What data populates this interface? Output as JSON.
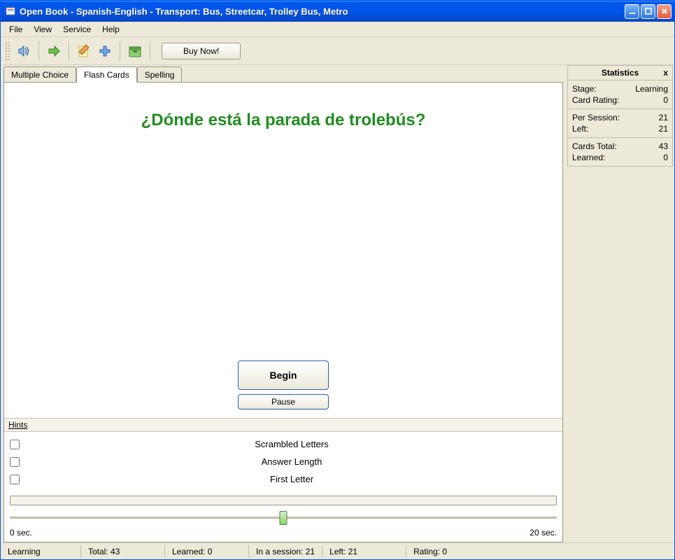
{
  "window": {
    "title": "Open Book - Spanish-English - Transport: Bus, Streetcar, Trolley Bus, Metro"
  },
  "menu": {
    "file": "File",
    "view": "View",
    "service": "Service",
    "help": "Help"
  },
  "toolbar": {
    "buy_now": "Buy Now!",
    "icons": {
      "sound": "speaker-icon",
      "next": "arrow-right-icon",
      "note": "notepad-icon",
      "add": "plus-icon",
      "box": "card-box-icon"
    }
  },
  "tabs": {
    "multiple_choice": "Multiple Choice",
    "flash_cards": "Flash Cards",
    "spelling": "Spelling",
    "active": "flash_cards"
  },
  "card": {
    "question": "¿Dónde está la parada de trolebús?",
    "begin": "Begin",
    "pause": "Pause"
  },
  "hints": {
    "title": "Hints",
    "scrambled": "Scrambled Letters",
    "answer_length": "Answer Length",
    "first_letter": "First Letter"
  },
  "timer": {
    "min_label": "0 sec.",
    "max_label": "20 sec."
  },
  "stats": {
    "title": "Statistics",
    "close": "x",
    "stage_label": "Stage:",
    "stage_value": "Learning",
    "rating_label": "Card Rating:",
    "rating_value": "0",
    "per_session_label": "Per Session:",
    "per_session_value": "21",
    "left_label": "Left:",
    "left_value": "21",
    "total_label": "Cards Total:",
    "total_value": "43",
    "learned_label": "Learned:",
    "learned_value": "0"
  },
  "status": {
    "mode": "Learning",
    "total": "Total: 43",
    "learned": "Learned: 0",
    "session": "In a session: 21",
    "left": "Left: 21",
    "rating": "Rating: 0"
  }
}
